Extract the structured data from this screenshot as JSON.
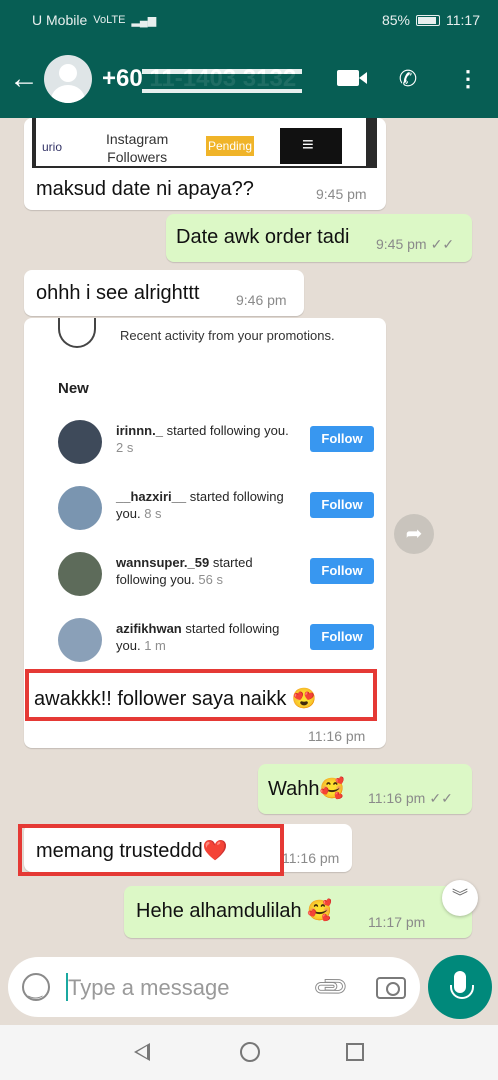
{
  "status_bar": {
    "carrier": "U Mobile",
    "volte": "VoLTE",
    "battery": "85%",
    "time": "11:17"
  },
  "header": {
    "contact": "+60 11-1403 3132"
  },
  "messages": [
    {
      "text": "maksud date ni apaya??",
      "time": "9:45 pm",
      "dir": "in"
    },
    {
      "text": "Date awk order tadi",
      "time": "9:45 pm",
      "dir": "out",
      "ticks": "✓✓"
    },
    {
      "text": "ohhh i see alrighttt",
      "time": "9:46 pm",
      "dir": "in"
    },
    {
      "text": "awakkk!!  follower saya naikk 😍",
      "time": "11:16 pm",
      "dir": "in"
    },
    {
      "text": "Wahh🥰",
      "time": "11:16 pm",
      "dir": "out",
      "ticks": "✓✓"
    },
    {
      "text": "memang trusteddd❤️",
      "time": "11:16 pm",
      "dir": "in"
    },
    {
      "text": "Hehe alhamdulilah 🥰",
      "time": "11:17 pm",
      "dir": "out"
    }
  ],
  "strip": {
    "label_line1": "Instagram",
    "label_line2": "Followers",
    "left": "urio",
    "pending": "Pending"
  },
  "insta": {
    "promo": "Recent activity from your promotions.",
    "new_heading": "New",
    "follow_label": "Follow",
    "rows": [
      {
        "user": "irinnn._",
        "action": "started following you.",
        "age": "2 s"
      },
      {
        "user": "__hazxiri__",
        "action": "started following you.",
        "age": "8 s"
      },
      {
        "user": "wannsuper._59",
        "action": "started following you.",
        "age": "56 s"
      },
      {
        "user": "azifikhwan",
        "action": "started following you.",
        "age": "1 m"
      }
    ]
  },
  "input": {
    "placeholder": "Type a message"
  }
}
